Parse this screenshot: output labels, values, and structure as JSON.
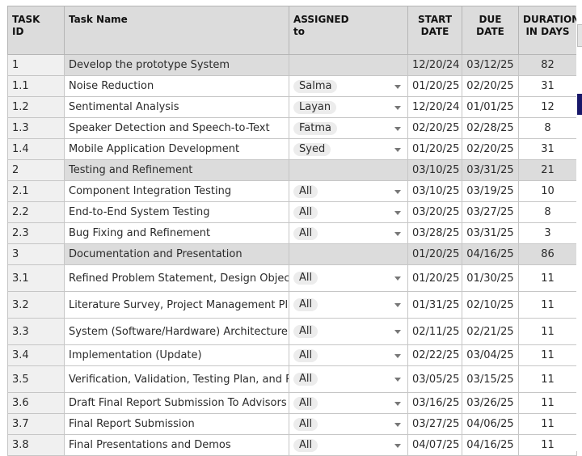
{
  "header": {
    "task_id": [
      "TASK",
      "ID"
    ],
    "task_name": "Task Name",
    "assigned": [
      "ASSIGNED",
      "to"
    ],
    "start": [
      "START",
      "DATE"
    ],
    "due": [
      "DUE",
      "DATE"
    ],
    "duration": [
      "DURATION",
      "IN DAYS"
    ]
  },
  "rows": [
    {
      "id": "1",
      "name": "Develop the prototype System",
      "assigned": "",
      "start": "12/20/24",
      "due": "03/12/25",
      "duration": "82",
      "parent": true
    },
    {
      "id": "1.1",
      "name": "Noise Reduction",
      "assigned": "Salma",
      "start": "01/20/25",
      "due": "02/20/25",
      "duration": "31"
    },
    {
      "id": "1.2",
      "name": "Sentimental Analysis",
      "assigned": "Layan",
      "start": "12/20/24",
      "due": "01/01/25",
      "duration": "12"
    },
    {
      "id": "1.3",
      "name": "Speaker Detection and  Speech-to-Text",
      "assigned": "Fatma",
      "start": "02/20/25",
      "due": "02/28/25",
      "duration": "8"
    },
    {
      "id": "1.4",
      "name": "Mobile Application Development",
      "assigned": "Syed",
      "start": "01/20/25",
      "due": "02/20/25",
      "duration": "31"
    },
    {
      "id": "2",
      "name": "Testing and Refinement",
      "assigned": "",
      "start": "03/10/25",
      "due": "03/31/25",
      "duration": "21",
      "parent": true
    },
    {
      "id": "2.1",
      "name": "Component Integration Testing",
      "assigned": "All",
      "start": "03/10/25",
      "due": "03/19/25",
      "duration": "10"
    },
    {
      "id": "2.2",
      "name": "End-to-End System Testing",
      "assigned": "All",
      "start": "03/20/25",
      "due": "03/27/25",
      "duration": "8"
    },
    {
      "id": "2.3",
      "name": "Bug Fixing and Refinement",
      "assigned": "All",
      "start": "03/28/25",
      "due": "03/31/25",
      "duration": "3"
    },
    {
      "id": "3",
      "name": "Documentation and Presentation",
      "assigned": "",
      "start": "01/20/25",
      "due": "04/16/25",
      "duration": "86",
      "parent": true
    },
    {
      "id": "3.1",
      "name": "Refined Problem Statement, Design Objectives, and Proposed Solution",
      "assigned": "All",
      "start": "01/20/25",
      "due": "01/30/25",
      "duration": "11",
      "tall": true
    },
    {
      "id": "3.2",
      "name": "Literature Survey, Project Management Plan and Standards",
      "assigned": "All",
      "start": "01/31/25",
      "due": "02/10/25",
      "duration": "11",
      "tall": true
    },
    {
      "id": "3.3",
      "name": "System (Software/Hardware) Architecture and Detailed Design",
      "assigned": "All",
      "start": "02/11/25",
      "due": "02/21/25",
      "duration": "11",
      "tall": true
    },
    {
      "id": "3.4",
      "name": "Implementation (Update)",
      "assigned": "All",
      "start": "02/22/25",
      "due": "03/04/25",
      "duration": "11"
    },
    {
      "id": "3.5",
      "name": "Verification, Validation, Testing Plan, and Result Analysis",
      "assigned": "All",
      "start": "03/05/25",
      "due": "03/15/25",
      "duration": "11",
      "tall": true
    },
    {
      "id": "3.6",
      "name": "Draft Final Report Submission To Advisors",
      "assigned": "All",
      "start": "03/16/25",
      "due": "03/26/25",
      "duration": "11"
    },
    {
      "id": "3.7",
      "name": "Final Report Submission",
      "assigned": "All",
      "start": "03/27/25",
      "due": "04/06/25",
      "duration": "11"
    },
    {
      "id": "3.8",
      "name": "Final Presentations and Demos",
      "assigned": "All",
      "start": "04/07/25",
      "due": "04/16/25",
      "duration": "11"
    }
  ]
}
